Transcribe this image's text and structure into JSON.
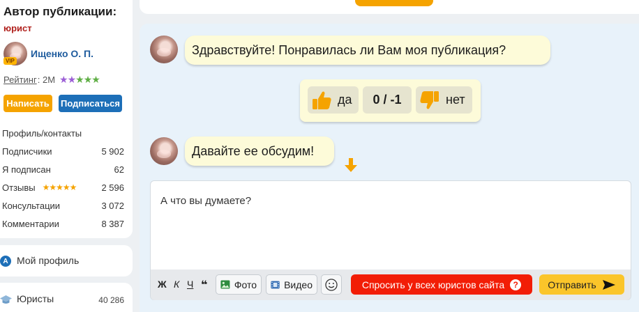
{
  "colors": {
    "accent_orange": "#f5a300",
    "brand_blue": "#1d6fb8",
    "role_red": "#b0201c",
    "ask_red": "#f21d06",
    "send_yellow": "#fbc52a",
    "bubble_bg": "#fdfbd9",
    "chat_bg": "#e8f2fa"
  },
  "author": {
    "title": "Автор публикации:",
    "role": "юрист",
    "vip": "VIP",
    "name": "Ищенко О. П.",
    "rating_label": "Рейтинг",
    "rating_value": ": 2М",
    "rating_stars_purple": "★★",
    "rating_stars_green": "★★★",
    "write_button": "Написать",
    "subscribe_button": "Подписаться"
  },
  "stats": {
    "profile_contacts": "Профиль/контакты",
    "subscribers_label": "Подписчики",
    "subscribers_value": "5 902",
    "subscribed_label": "Я подписан",
    "subscribed_value": "62",
    "reviews_label": "Отзывы",
    "reviews_stars": "★★★★★",
    "reviews_value": "2 596",
    "consultations_label": "Консультации",
    "consultations_value": "3 072",
    "comments_label": "Комментарии",
    "comments_value": "8 387"
  },
  "nav": {
    "profile_icon": "A",
    "my_profile": "Мой профиль",
    "lawyers": "Юристы",
    "lawyers_count": "40 286"
  },
  "chat": {
    "message_1": "Здравствуйте! Понравилась ли Вам моя публикация?",
    "vote_yes": "да",
    "vote_score": "0 / -1",
    "vote_no": "нет",
    "message_2": "Давайте ее обсудим!"
  },
  "composer": {
    "text": "А что вы думаете?",
    "bold": "Ж",
    "italic": "К",
    "underline": "Ч",
    "quote": "❝",
    "photo": "Фото",
    "video": "Видео",
    "ask_all": "Спросить у всех юристов сайта",
    "ask_icon": "?",
    "send": "Отправить"
  },
  "icons": {
    "thumb_up": "thumb-up-icon",
    "thumb_down": "thumb-down-icon",
    "photo": "image-icon",
    "video": "film-icon",
    "emoji": "smiley-icon",
    "send": "send-arrow-icon",
    "arrow": "arrow-down-icon",
    "lawyers": "graduation-cap-icon"
  }
}
